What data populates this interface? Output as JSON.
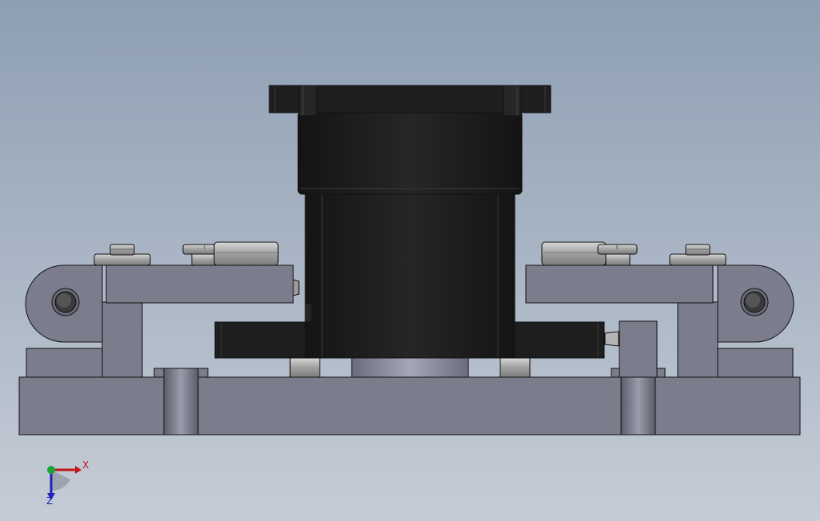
{
  "viewport": {
    "background_top": "#8e9fb3",
    "background_bottom": "#c5ccd6"
  },
  "triad": {
    "x_label": "X",
    "z_label": "Z",
    "x_color": "#c01818",
    "z_color": "#2222b8",
    "y_color": "#1aa33a"
  },
  "colors": {
    "body": "#7b7d8c",
    "body_dark": "#5e6070",
    "edge": "#111111",
    "motor": "#1e1e1e",
    "motor_highlight": "#2e2e2e",
    "metal": "#a7a8a8",
    "metal_light": "#c6c6c6"
  }
}
